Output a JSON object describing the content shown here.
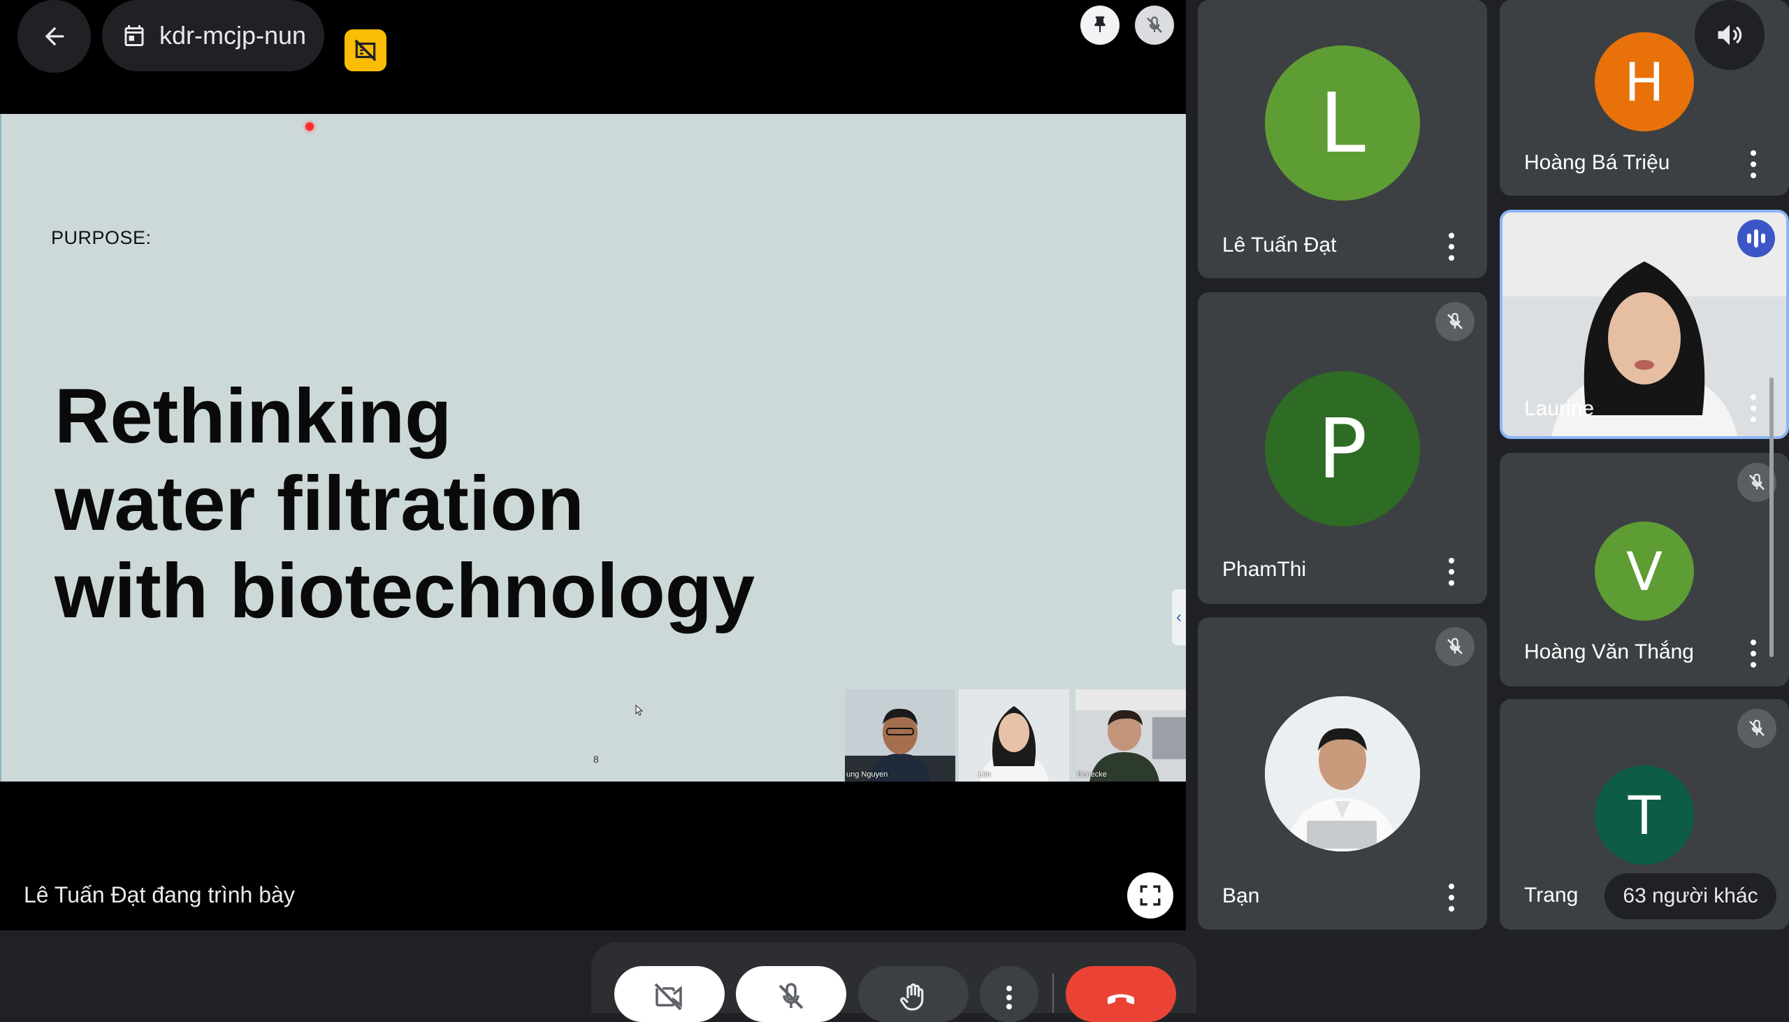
{
  "header": {
    "meeting_code": "kdr-mcjp-nun"
  },
  "slide": {
    "label": "PURPOSE:",
    "title_lines": [
      "Rethinking",
      "water filtration",
      "with biotechnology"
    ],
    "page_number": "8",
    "thumbnails": [
      {
        "label": "ung Nguyen"
      },
      {
        "label": "Lim"
      },
      {
        "label": "Benecke"
      }
    ]
  },
  "presenting": {
    "text": "Lê Tuấn Đạt đang trình bày"
  },
  "participants": {
    "le_tuan_dat": {
      "initial": "L",
      "name": "Lê Tuấn Đạt",
      "color": "#5e9d34"
    },
    "pham_thi": {
      "initial": "P",
      "name": "PhamThi",
      "color": "#2e6b24"
    },
    "ban": {
      "name": "Bạn"
    },
    "hoang_ba_trieu": {
      "initial": "H",
      "name": "Hoàng Bá Triệu",
      "color": "#e8710a"
    },
    "laurine": {
      "name": "Laurine"
    },
    "hoang_van_thang": {
      "initial": "V",
      "name": "Hoàng Văn Thắng",
      "color": "#5e9d34"
    },
    "trang": {
      "initial": "T",
      "name": "Trang",
      "color": "#0d5c46"
    },
    "others_count": "63 người khác"
  },
  "colors": {
    "background": "#202124",
    "tile": "#3c4043",
    "accent_blue": "#8ab4f8",
    "end_call_red": "#ea4335",
    "rec_yellow": "#fbbc04"
  },
  "icons": {
    "back": "arrow-left-icon",
    "calendar": "calendar-icon",
    "recording": "recording-off-icon",
    "pin": "pin-icon",
    "mic_off": "mic-off-icon",
    "volume": "volume-icon",
    "fullscreen": "fullscreen-icon",
    "camera_off": "camera-off-icon",
    "raise_hand": "raise-hand-icon",
    "more": "more-vert-icon",
    "end_call": "call-end-icon",
    "speaking": "speaking-indicator-icon"
  }
}
